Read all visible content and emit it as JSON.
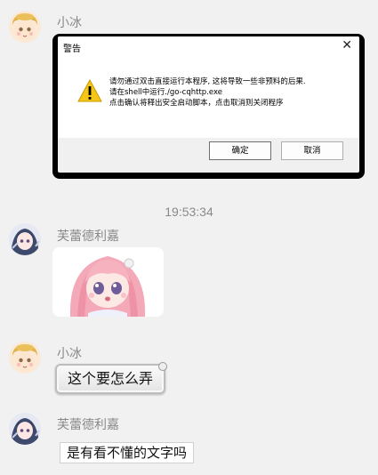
{
  "messages": [
    {
      "sender": "小冰",
      "type": "image",
      "dialog": {
        "title": "警告",
        "close_glyph": "✕",
        "lines": [
          "请勿通过双击直接运行本程序, 这将导致一些非预料的后果.",
          "请在shell中运行./go-cqhttp.exe",
          "点击确认将释出安全启动脚本，点击取消则关闭程序"
        ],
        "ok_label": "确定",
        "cancel_label": "取消"
      }
    },
    {
      "sender": "芙蕾德利嘉",
      "type": "sticker"
    },
    {
      "sender": "小冰",
      "type": "text",
      "text": "这个要怎么弄"
    },
    {
      "sender": "芙蕾德利嘉",
      "type": "text",
      "text": "是有看不懂的文字吗"
    }
  ],
  "timestamp": "19:53:34",
  "icons": {
    "warning": "warning-triangle-icon",
    "close": "close-icon"
  },
  "colors": {
    "background": "#f1f1f1",
    "warning_yellow": "#f5c518",
    "sender_text": "#888888"
  }
}
